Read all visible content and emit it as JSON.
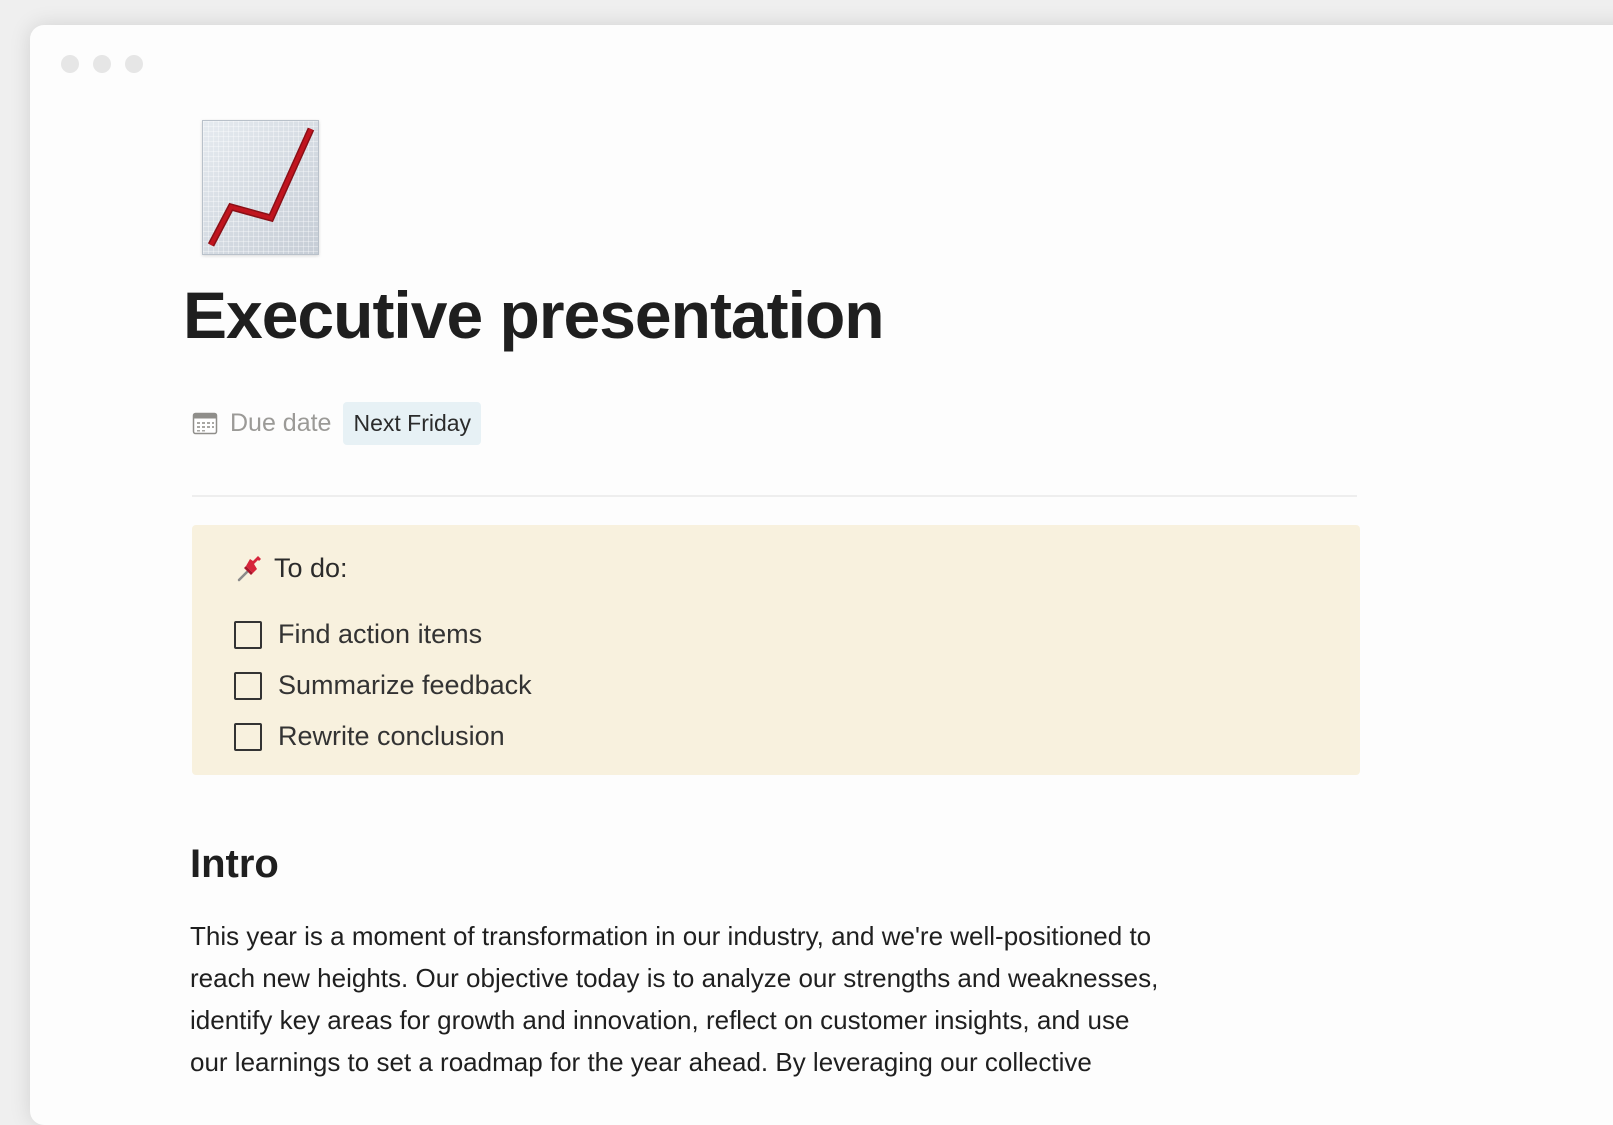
{
  "page": {
    "title": "Executive presentation",
    "icon": "chart-increasing-icon"
  },
  "properties": {
    "due_date": {
      "icon": "calendar-icon",
      "label": "Due date",
      "value": "Next Friday"
    }
  },
  "callout": {
    "icon": "pushpin-icon",
    "heading": "To do:",
    "items": [
      {
        "label": "Find action items",
        "checked": false
      },
      {
        "label": "Summarize feedback",
        "checked": false
      },
      {
        "label": "Rewrite conclusion",
        "checked": false
      }
    ]
  },
  "intro": {
    "heading": "Intro",
    "lines": [
      "This year is a moment of transformation in our industry, and we're well-positioned to",
      "reach new heights. Our objective today is to analyze our strengths and weaknesses,",
      "identify key areas for growth and innovation, reflect on customer insights, and use",
      "our learnings to set a roadmap for the year ahead. By leveraging our collective"
    ]
  },
  "colors": {
    "callout_background": "#f8f1de",
    "date_chip_background": "#e7f1f5",
    "chart_line": "#c0141e"
  }
}
